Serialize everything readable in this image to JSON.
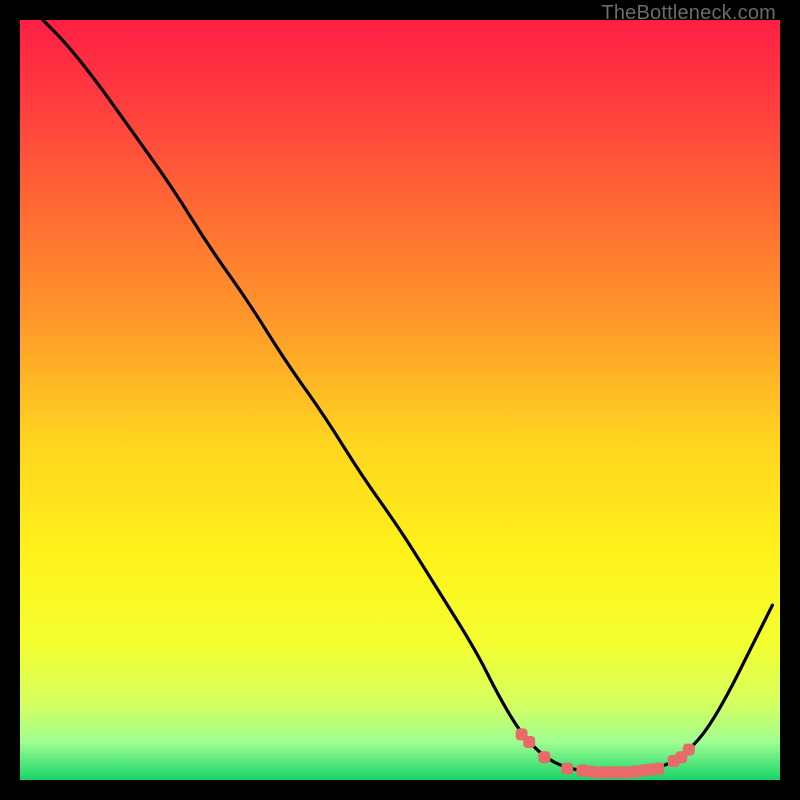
{
  "watermark": "TheBottleneck.com",
  "chart_data": {
    "type": "line",
    "title": "",
    "xlabel": "",
    "ylabel": "",
    "xlim": [
      0,
      100
    ],
    "ylim": [
      0,
      100
    ],
    "gradient_stops": [
      {
        "offset": 0.0,
        "color": "#ff1f44"
      },
      {
        "offset": 0.1,
        "color": "#ff3a3f"
      },
      {
        "offset": 0.25,
        "color": "#ff6a33"
      },
      {
        "offset": 0.4,
        "color": "#ff9a2a"
      },
      {
        "offset": 0.55,
        "color": "#ffd320"
      },
      {
        "offset": 0.7,
        "color": "#fff21a"
      },
      {
        "offset": 0.82,
        "color": "#f4ff30"
      },
      {
        "offset": 0.9,
        "color": "#d4ff60"
      },
      {
        "offset": 0.95,
        "color": "#9fff90"
      },
      {
        "offset": 1.0,
        "color": "#17d36b"
      }
    ],
    "curve": [
      {
        "x": 3,
        "y": 100
      },
      {
        "x": 6,
        "y": 97
      },
      {
        "x": 10,
        "y": 92
      },
      {
        "x": 15,
        "y": 85
      },
      {
        "x": 20,
        "y": 78
      },
      {
        "x": 25,
        "y": 70
      },
      {
        "x": 30,
        "y": 63
      },
      {
        "x": 35,
        "y": 55
      },
      {
        "x": 40,
        "y": 48
      },
      {
        "x": 45,
        "y": 40
      },
      {
        "x": 50,
        "y": 33
      },
      {
        "x": 55,
        "y": 25
      },
      {
        "x": 60,
        "y": 17
      },
      {
        "x": 63,
        "y": 11
      },
      {
        "x": 66,
        "y": 6
      },
      {
        "x": 69,
        "y": 3
      },
      {
        "x": 72,
        "y": 1.5
      },
      {
        "x": 76,
        "y": 1
      },
      {
        "x": 80,
        "y": 1
      },
      {
        "x": 84,
        "y": 1.5
      },
      {
        "x": 87,
        "y": 3
      },
      {
        "x": 90,
        "y": 6
      },
      {
        "x": 93,
        "y": 11
      },
      {
        "x": 96,
        "y": 17
      },
      {
        "x": 99,
        "y": 23
      }
    ],
    "markers_x": [
      66,
      67,
      69,
      72,
      74,
      75,
      76,
      77,
      78,
      79,
      80,
      81,
      82,
      83,
      84,
      86,
      87,
      88
    ]
  }
}
